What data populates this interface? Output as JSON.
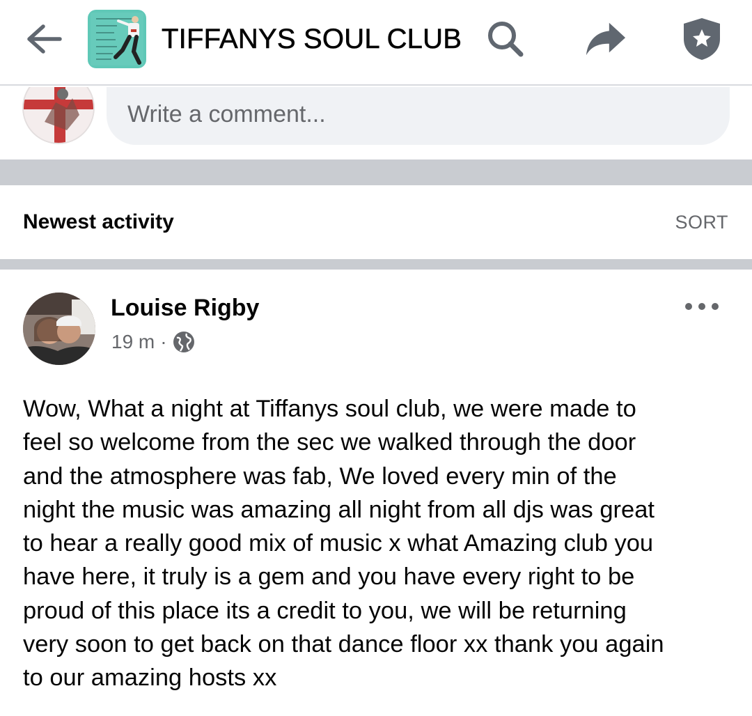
{
  "header": {
    "title": "TIFFANYS SOUL CLUB",
    "back_icon": "arrow-left-icon",
    "search_icon": "search-icon",
    "share_icon": "share-arrow-icon",
    "admin_icon": "shield-star-icon"
  },
  "composer": {
    "placeholder": "Write a comment..."
  },
  "sort": {
    "title": "Newest activity",
    "button": "SORT"
  },
  "post": {
    "author": "Louise Rigby",
    "time": "19 m",
    "separator": "·",
    "privacy_icon": "globe-icon",
    "more_icon": "more-horizontal-icon",
    "body": "Wow, What a night at Tiffanys soul club, we were made to\nfeel so welcome from the sec we walked through the door\nand the atmosphere was fab, We loved every min of the\nnight the music was amazing all night from all djs was great\nto hear a really good mix of music x what Amazing club you\nhave here, it truly is a gem and you have every right to be\nproud of this place its a credit to you, we will be returning\nvery soon to get back on that dance floor xx thank you again\nto our amazing hosts xx"
  },
  "colors": {
    "text_primary": "#050505",
    "text_secondary": "#65676b",
    "input_bg": "#f0f2f5",
    "divider": "#c9ccd1",
    "icon_gray": "#606770",
    "group_thumb": "#5fc8b7"
  }
}
